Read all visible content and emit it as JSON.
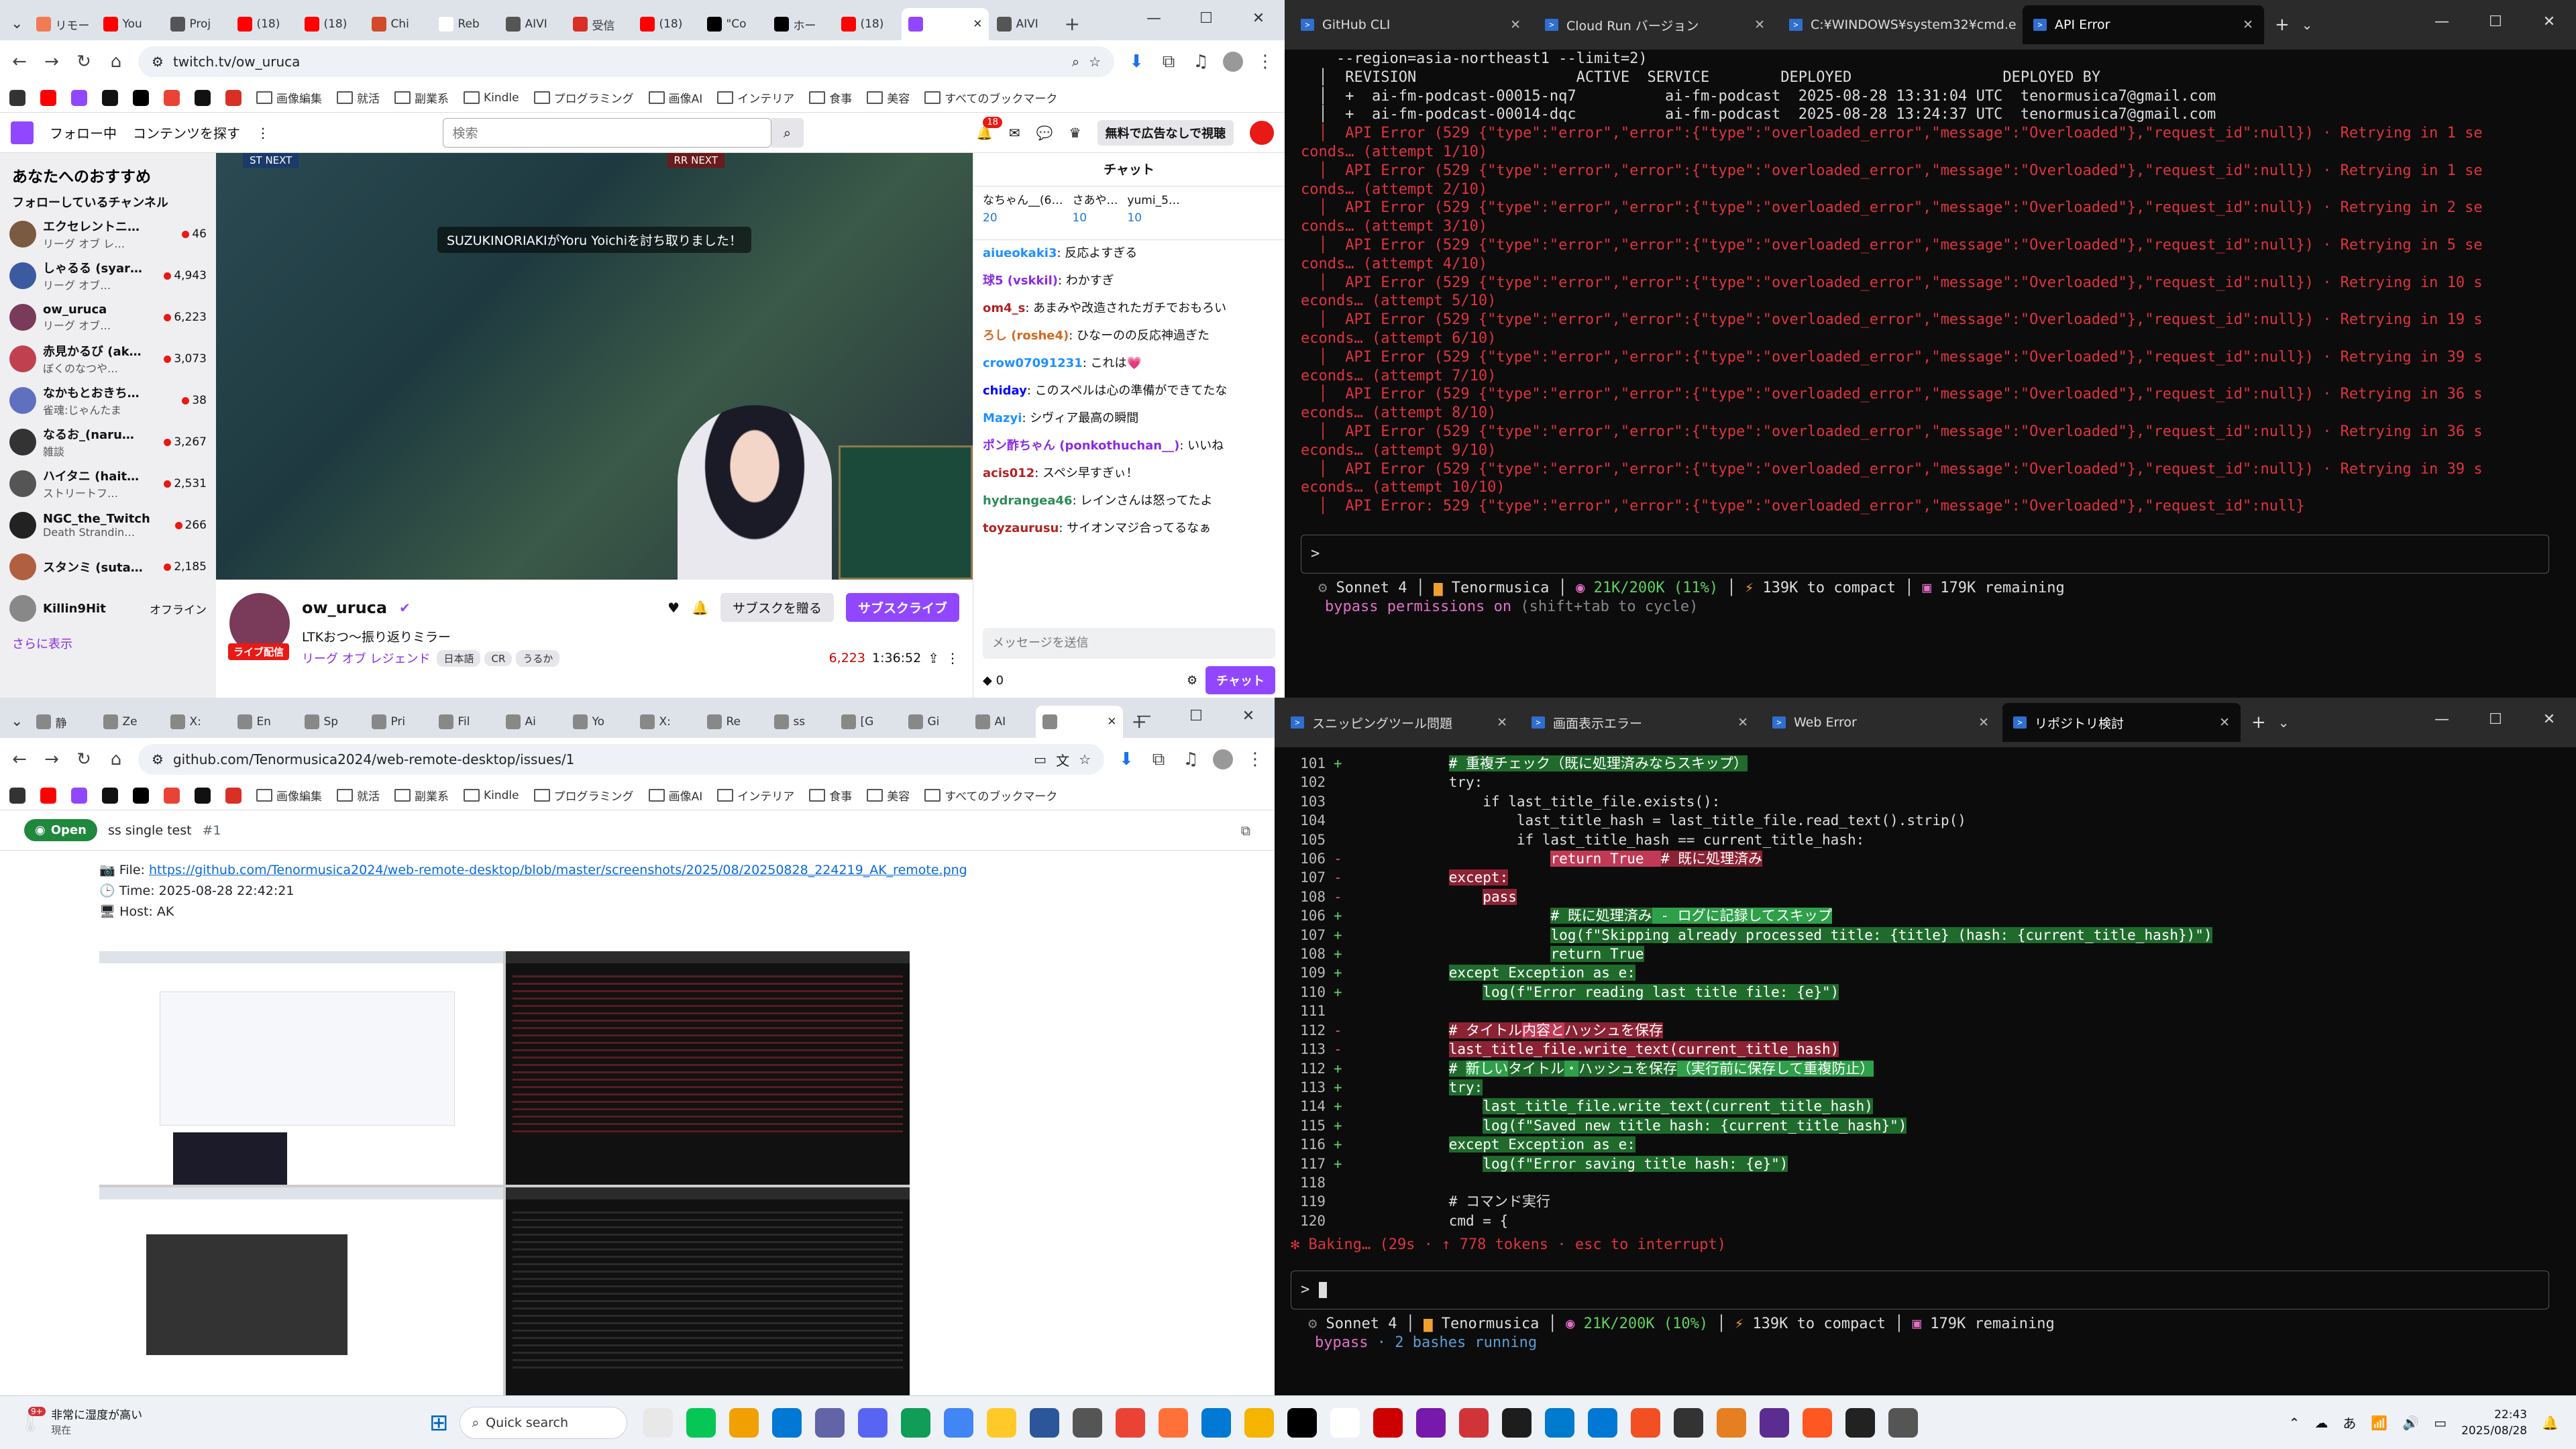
{
  "twitch_window": {
    "tabs": [
      {
        "label": "リモー",
        "color": "#f27a54"
      },
      {
        "label": "You",
        "color": "#ff0000"
      },
      {
        "label": "Proj",
        "color": "#555555"
      },
      {
        "label": "(18)",
        "color": "#ff0000"
      },
      {
        "label": "(18)",
        "color": "#ff0000"
      },
      {
        "label": "Chi",
        "color": "#d14b2a"
      },
      {
        "label": "Reb",
        "color": "#ffffff"
      },
      {
        "label": "AIVI",
        "color": "#555555"
      },
      {
        "label": "受信",
        "color": "#d93025"
      },
      {
        "label": "(18)",
        "color": "#ff0000"
      },
      {
        "label": "\"Co",
        "color": "#000000"
      },
      {
        "label": "ホー",
        "color": "#000000"
      },
      {
        "label": "(18)",
        "color": "#ff0000"
      },
      {
        "label": "",
        "color": "#9147ff",
        "active": true
      },
      {
        "label": "AIVI",
        "color": "#555555"
      }
    ],
    "url": "twitch.tv/ow_uruca",
    "bookmarks": [
      "画像編集",
      "就活",
      "副業系",
      "Kindle",
      "プログラミング",
      "画像AI",
      "インテリア",
      "食事",
      "美容",
      "すべてのブックマーク"
    ],
    "topbar": {
      "following": "フォロー中",
      "browse": "コンテンツを探す",
      "search_placeholder": "検索",
      "badge": "18",
      "ad_free": "無料で広告なしで視聴"
    },
    "sidebar": {
      "title": "あなたへのおすすめ",
      "subtitle": "フォローしているチャンネル",
      "channels": [
        {
          "name": "エクセレントニ…",
          "game": "リーグ オブ レ…",
          "viewers": "46",
          "color": "#7a5a40"
        },
        {
          "name": "しゃるる (syar…",
          "game": "リーグ オブ…",
          "viewers": "4,943",
          "color": "#3c5aa0"
        },
        {
          "name": "ow_uruca",
          "game": "リーグ オブ…",
          "viewers": "6,223",
          "color": "#7a3a5a"
        },
        {
          "name": "赤見かるび (ak…",
          "game": "ぼくのなつや…",
          "viewers": "3,073",
          "color": "#c04050"
        },
        {
          "name": "なかもとおきち…",
          "game": "雀魂:じゃんたま",
          "viewers": "38",
          "color": "#6070c0"
        },
        {
          "name": "なるお_(naru…",
          "game": "雑談",
          "viewers": "3,267",
          "color": "#333333"
        },
        {
          "name": "ハイタニ (hait…",
          "game": "ストリートフ…",
          "viewers": "2,531",
          "color": "#555555"
        },
        {
          "name": "NGC_the_Twitch",
          "game": "Death Strandin…",
          "viewers": "266",
          "color": "#222222"
        },
        {
          "name": "スタンミ (suta…",
          "game": "",
          "viewers": "2,185",
          "color": "#b06040"
        },
        {
          "name": "Killin9Hit",
          "game": "",
          "viewers": "オフライン",
          "color": "#888888"
        }
      ],
      "more": "さらに表示"
    },
    "video": {
      "kill_feed": "SUZUKINORIAKIがYoru Yoichiを討ち取りました！",
      "hud_left": "ST NEXT",
      "hud_right": "RR NEXT"
    },
    "stream": {
      "name": "ow_uruca",
      "title": "LTKおつ〜振り返りミラー",
      "game": "リーグ オブ レジェンド",
      "tags": [
        "日本語",
        "CR",
        "うるか"
      ],
      "live": "ライブ配信",
      "viewers": "6,223",
      "uptime": "1:36:52",
      "gift_btn": "サブスクを贈る",
      "sub_btn": "サブスクライブ"
    },
    "chat": {
      "header": "チャット",
      "gifts": [
        {
          "name": "なちゃん__(6…",
          "count": "20"
        },
        {
          "name": "さあや…",
          "count": "10"
        },
        {
          "name": "yumi_5…",
          "count": "10"
        }
      ],
      "messages": [
        {
          "user": "aiueokaki3",
          "color": "#1e90ff",
          "text": "反応よすぎる"
        },
        {
          "user": "球5 (vskkil)",
          "color": "#8a2be2",
          "text": "わかすぎ"
        },
        {
          "user": "om4_s",
          "color": "#b22222",
          "text": "あまみや改造されたガチでおもろい"
        },
        {
          "user": "ろし (roshe4)",
          "color": "#d2691e",
          "text": "ひなーのの反応神過ぎた"
        },
        {
          "user": "crow07091231",
          "color": "#1e90ff",
          "text": "これは💗"
        },
        {
          "user": "chiday",
          "color": "#0000ff",
          "text": "このスペルは心の準備ができてたな"
        },
        {
          "user": "Mazyi",
          "color": "#1e90ff",
          "text": "シヴィア最高の瞬間"
        },
        {
          "user": "ポン酢ちゃん (ponkothuchan__)",
          "color": "#8a2be2",
          "text": "いいね"
        },
        {
          "user": "acis012",
          "color": "#b22222",
          "text": "スペシ早すぎぃ！"
        },
        {
          "user": "hydrangea46",
          "color": "#2e8b57",
          "text": "レインさんは怒ってたよ"
        },
        {
          "user": "toyzaurusu",
          "color": "#b22222",
          "text": "サイオンマジ合ってるなぁ"
        }
      ],
      "input_placeholder": "メッセージを送信",
      "points": "0",
      "send": "チャット"
    }
  },
  "terminal_top": {
    "tabs": [
      {
        "label": "GitHub CLI"
      },
      {
        "label": "Cloud Run バージョン"
      },
      {
        "label": "C:¥WINDOWS¥system32¥cmd.e"
      },
      {
        "label": "API Error",
        "active": true
      }
    ],
    "lines": [
      {
        "t": "    --region=asia-northeast1 --limit=2)",
        "c": ""
      },
      {
        "t": "  │  REVISION                  ACTIVE  SERVICE        DEPLOYED                 DEPLOYED BY",
        "c": ""
      },
      {
        "t": "  │  +  ai-fm-podcast-00015-nq7          ai-fm-podcast  2025-08-28 13:31:04 UTC  tenormusica7@gmail.com",
        "c": ""
      },
      {
        "t": "  │  +  ai-fm-podcast-00014-dqc          ai-fm-podcast  2025-08-28 13:24:37 UTC  tenormusica7@gmail.com",
        "c": ""
      },
      {
        "t": "  │  API Error (529 {\"type\":\"error\",\"error\":{\"type\":\"overloaded_error\",\"message\":\"Overloaded\"},\"request_id\":null}) · Retrying in 1 se",
        "c": "red"
      },
      {
        "t": "conds… (attempt 1/10)",
        "c": "red"
      },
      {
        "t": "  │  API Error (529 {\"type\":\"error\",\"error\":{\"type\":\"overloaded_error\",\"message\":\"Overloaded\"},\"request_id\":null}) · Retrying in 1 se",
        "c": "red"
      },
      {
        "t": "conds… (attempt 2/10)",
        "c": "red"
      },
      {
        "t": "  │  API Error (529 {\"type\":\"error\",\"error\":{\"type\":\"overloaded_error\",\"message\":\"Overloaded\"},\"request_id\":null}) · Retrying in 2 se",
        "c": "red"
      },
      {
        "t": "conds… (attempt 3/10)",
        "c": "red"
      },
      {
        "t": "  │  API Error (529 {\"type\":\"error\",\"error\":{\"type\":\"overloaded_error\",\"message\":\"Overloaded\"},\"request_id\":null}) · Retrying in 5 se",
        "c": "red"
      },
      {
        "t": "conds… (attempt 4/10)",
        "c": "red"
      },
      {
        "t": "  │  API Error (529 {\"type\":\"error\",\"error\":{\"type\":\"overloaded_error\",\"message\":\"Overloaded\"},\"request_id\":null}) · Retrying in 10 s",
        "c": "red"
      },
      {
        "t": "econds… (attempt 5/10)",
        "c": "red"
      },
      {
        "t": "  │  API Error (529 {\"type\":\"error\",\"error\":{\"type\":\"overloaded_error\",\"message\":\"Overloaded\"},\"request_id\":null}) · Retrying in 19 s",
        "c": "red"
      },
      {
        "t": "econds… (attempt 6/10)",
        "c": "red"
      },
      {
        "t": "  │  API Error (529 {\"type\":\"error\",\"error\":{\"type\":\"overloaded_error\",\"message\":\"Overloaded\"},\"request_id\":null}) · Retrying in 39 s",
        "c": "red"
      },
      {
        "t": "econds… (attempt 7/10)",
        "c": "red"
      },
      {
        "t": "  │  API Error (529 {\"type\":\"error\",\"error\":{\"type\":\"overloaded_error\",\"message\":\"Overloaded\"},\"request_id\":null}) · Retrying in 36 s",
        "c": "red"
      },
      {
        "t": "econds… (attempt 8/10)",
        "c": "red"
      },
      {
        "t": "  │  API Error (529 {\"type\":\"error\",\"error\":{\"type\":\"overloaded_error\",\"message\":\"Overloaded\"},\"request_id\":null}) · Retrying in 36 s",
        "c": "red"
      },
      {
        "t": "econds… (attempt 9/10)",
        "c": "red"
      },
      {
        "t": "  │  API Error (529 {\"type\":\"error\",\"error\":{\"type\":\"overloaded_error\",\"message\":\"Overloaded\"},\"request_id\":null}) · Retrying in 39 s",
        "c": "red"
      },
      {
        "t": "econds… (attempt 10/10)",
        "c": "red"
      },
      {
        "t": "  │  API Error: 529 {\"type\":\"error\",\"error\":{\"type\":\"overloaded_error\",\"message\":\"Overloaded\"},\"request_id\":null}",
        "c": "red"
      }
    ],
    "prompt": ">",
    "status_model": "Sonnet 4",
    "status_dir": "Tenormusica",
    "status_ctx": "21K/200K (11%)",
    "status_compact": "139K to compact",
    "status_remaining": "179K remaining",
    "bypass": "bypass permissions on",
    "bypass_hint": "(shift+tab to cycle)"
  },
  "github_window": {
    "tabs": [
      {
        "label": "静"
      },
      {
        "label": "Ze"
      },
      {
        "label": "X:"
      },
      {
        "label": "En"
      },
      {
        "label": "Sp"
      },
      {
        "label": "Pri"
      },
      {
        "label": "Fil"
      },
      {
        "label": "Ai"
      },
      {
        "label": "Yo"
      },
      {
        "label": "X:"
      },
      {
        "label": "Re"
      },
      {
        "label": "ss"
      },
      {
        "label": "[G"
      },
      {
        "label": "Gi"
      },
      {
        "label": "AI"
      },
      {
        "label": "",
        "active": true
      }
    ],
    "url": "github.com/Tenormusica2024/web-remote-desktop/issues/1",
    "issue": {
      "state": "Open",
      "title": "ss single test",
      "number": "#1"
    },
    "file_label": "File:",
    "file_link": "https://github.com/Tenormusica2024/web-remote-desktop/blob/master/screenshots/2025/08/20250828_224219_AK_remote.png",
    "time_label": "Time:",
    "time_value": "2025-08-28 22:42:21",
    "host_label": "Host:",
    "host_value": "AK"
  },
  "terminal_bottom": {
    "tabs": [
      {
        "label": "スニッピングツール問題"
      },
      {
        "label": "画面表示エラー"
      },
      {
        "label": "Web Error"
      },
      {
        "label": "リポジトリ検討",
        "active": true
      }
    ],
    "diff": [
      {
        "n": "101",
        "s": "+",
        "k": "add",
        "segs": [
          {
            "t": "            "
          },
          {
            "t": "# 重複チェック（既に処理済みならスキップ）",
            "h": "hla"
          }
        ]
      },
      {
        "n": "102",
        "s": "",
        "k": "",
        "segs": [
          {
            "t": "            try:"
          }
        ]
      },
      {
        "n": "103",
        "s": "",
        "k": "",
        "segs": [
          {
            "t": "                if last_title_file.exists():"
          }
        ]
      },
      {
        "n": "104",
        "s": "",
        "k": "",
        "segs": [
          {
            "t": "                    last_title_hash = last_title_file.read_text().strip()"
          }
        ]
      },
      {
        "n": "105",
        "s": "",
        "k": "",
        "segs": [
          {
            "t": "                    if last_title_hash == current_title_hash:"
          }
        ]
      },
      {
        "n": "106",
        "s": "-",
        "k": "del",
        "segs": [
          {
            "t": "                        "
          },
          {
            "t": "return True  ",
            "h": "hld2"
          },
          {
            "t": "# 既に処理済み",
            "h": "hld"
          }
        ]
      },
      {
        "n": "107",
        "s": "-",
        "k": "del",
        "segs": [
          {
            "t": "            "
          },
          {
            "t": "except:",
            "h": "hld"
          }
        ]
      },
      {
        "n": "108",
        "s": "-",
        "k": "del",
        "segs": [
          {
            "t": "                "
          },
          {
            "t": "pass",
            "h": "hld"
          }
        ]
      },
      {
        "n": "106",
        "s": "+",
        "k": "add",
        "segs": [
          {
            "t": "                        "
          },
          {
            "t": "# 既に処理済み",
            "h": "hla"
          },
          {
            "t": " - ログに記録してスキップ",
            "h": "hla2"
          }
        ]
      },
      {
        "n": "107",
        "s": "+",
        "k": "add",
        "segs": [
          {
            "t": "                        "
          },
          {
            "t": "log(f\"Skipping already processed title: {title} (hash: {current_title_hash})\")",
            "h": "hla"
          }
        ]
      },
      {
        "n": "108",
        "s": "+",
        "k": "add",
        "segs": [
          {
            "t": "                        "
          },
          {
            "t": "return True",
            "h": "hla"
          }
        ]
      },
      {
        "n": "109",
        "s": "+",
        "k": "add",
        "segs": [
          {
            "t": "            "
          },
          {
            "t": "except Exception as e:",
            "h": "hla"
          }
        ]
      },
      {
        "n": "110",
        "s": "+",
        "k": "add",
        "segs": [
          {
            "t": "                "
          },
          {
            "t": "log(f\"Error reading last title file: {e}\")",
            "h": "hla"
          }
        ]
      },
      {
        "n": "111",
        "s": "",
        "k": "",
        "segs": [
          {
            "t": ""
          }
        ]
      },
      {
        "n": "112",
        "s": "-",
        "k": "del",
        "segs": [
          {
            "t": "            "
          },
          {
            "t": "# タイトル",
            "h": "hld"
          },
          {
            "t": "内容と",
            "h": "hld2"
          },
          {
            "t": "ハッシュを保存",
            "h": "hld"
          }
        ]
      },
      {
        "n": "113",
        "s": "-",
        "k": "del",
        "segs": [
          {
            "t": "            "
          },
          {
            "t": "last_title_file.write_text(current_title_hash)",
            "h": "hld"
          }
        ]
      },
      {
        "n": "112",
        "s": "+",
        "k": "add",
        "segs": [
          {
            "t": "            "
          },
          {
            "t": "# ",
            "h": "hla"
          },
          {
            "t": "新しい",
            "h": "hla2"
          },
          {
            "t": "タイトル",
            "h": "hla"
          },
          {
            "t": "・",
            "h": "hla2"
          },
          {
            "t": "ハッシュを保存",
            "h": "hla"
          },
          {
            "t": "（実行前に保存して重複防止）",
            "h": "hla2"
          }
        ]
      },
      {
        "n": "113",
        "s": "+",
        "k": "add",
        "segs": [
          {
            "t": "            "
          },
          {
            "t": "try:",
            "h": "hla"
          }
        ]
      },
      {
        "n": "114",
        "s": "+",
        "k": "add",
        "segs": [
          {
            "t": "                "
          },
          {
            "t": "last_title_file.write_text(current_title_hash)",
            "h": "hla"
          }
        ]
      },
      {
        "n": "115",
        "s": "+",
        "k": "add",
        "segs": [
          {
            "t": "                "
          },
          {
            "t": "log(f\"Saved new title hash: {current_title_hash}\")",
            "h": "hla"
          }
        ]
      },
      {
        "n": "116",
        "s": "+",
        "k": "add",
        "segs": [
          {
            "t": "            "
          },
          {
            "t": "except Exception as e:",
            "h": "hla"
          }
        ]
      },
      {
        "n": "117",
        "s": "+",
        "k": "add",
        "segs": [
          {
            "t": "                "
          },
          {
            "t": "log(f\"Error saving title hash: {e}\")",
            "h": "hla"
          }
        ]
      },
      {
        "n": "118",
        "s": "",
        "k": "",
        "segs": [
          {
            "t": ""
          }
        ]
      },
      {
        "n": "119",
        "s": "",
        "k": "",
        "segs": [
          {
            "t": "            # コマンド実行"
          }
        ]
      },
      {
        "n": "120",
        "s": "",
        "k": "",
        "segs": [
          {
            "t": "            cmd = {"
          }
        ]
      }
    ],
    "baking": "✻ Baking… (29s · ↑ 778 tokens · esc to interrupt)",
    "prompt": "> ",
    "status_model": "Sonnet 4",
    "status_dir": "Tenormusica",
    "status_ctx": "21K/200K (10%)",
    "status_compact": "139K to compact",
    "status_remaining": "179K remaining",
    "bypass": "bypass",
    "bashes": "· 2 bashes running"
  },
  "taskbar": {
    "weather_badge": "9+",
    "weather_title": "非常に湿度が高い",
    "weather_sub": "現在",
    "search_placeholder": "Quick search",
    "apps": [
      "#e8e8e8",
      "#06c755",
      "#f0a000",
      "#0078d4",
      "#6264a7",
      "#5865f2",
      "#0f9d58",
      "#4285f4",
      "#ffca28",
      "#2b579a",
      "#555555",
      "#ea4335",
      "#ff7139",
      "#0078d4",
      "#f4b400",
      "#000000",
      "#ffffff",
      "#cc0000",
      "#7719aa",
      "#d13438",
      "#1d1d1d",
      "#007acc",
      "#0078d4",
      "#f25022",
      "#333333",
      "#e67e22",
      "#5c2d91",
      "#ff5722",
      "#222222",
      "#555555"
    ],
    "time": "22:43",
    "date": "2025/08/28",
    "ime": "あ"
  }
}
